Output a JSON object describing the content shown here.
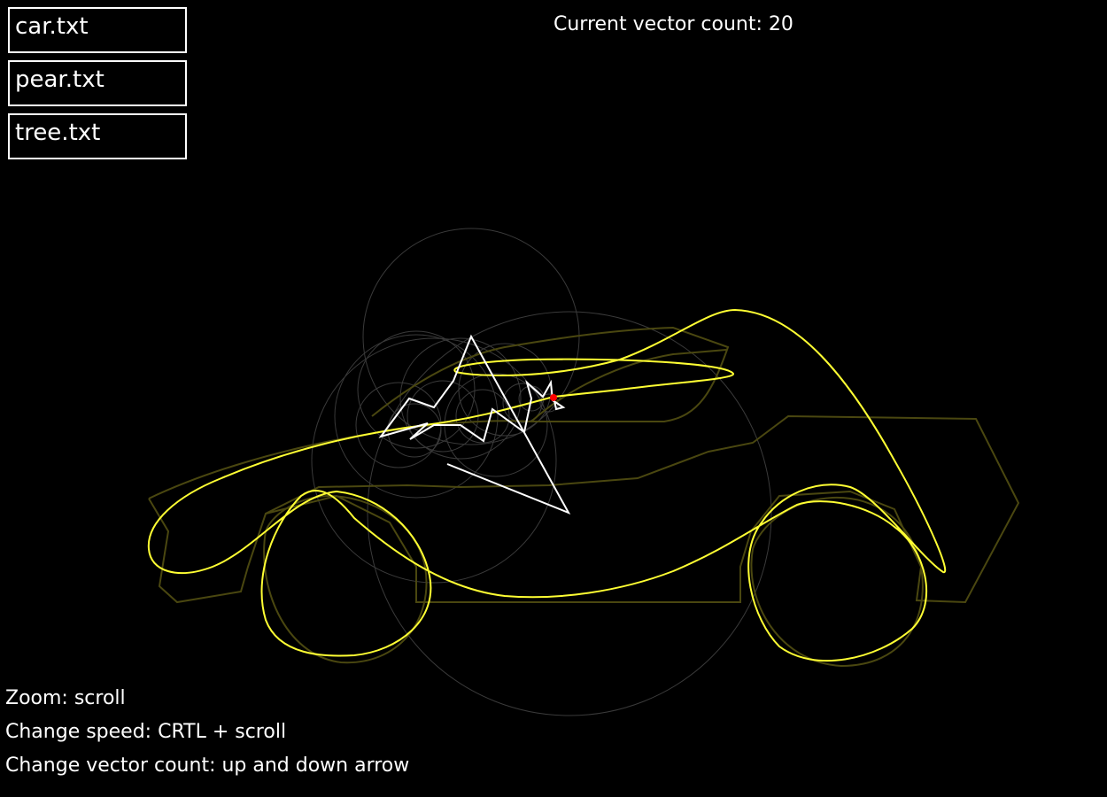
{
  "files": [
    {
      "label": "car.txt"
    },
    {
      "label": "pear.txt"
    },
    {
      "label": "tree.txt"
    }
  ],
  "status": {
    "vector_count_label": "Current vector count:",
    "vector_count": "20"
  },
  "help": {
    "zoom": "Zoom: scroll",
    "speed": "Change speed: CRTL + scroll",
    "vector": "Change vector count: up and down arrow"
  },
  "colors": {
    "background": "#000000",
    "trace": "#ffff33",
    "target_outline": "#4a4710",
    "vectors": "#ffffff",
    "circles": "#3a3a3a",
    "tip": "#ff0000"
  }
}
